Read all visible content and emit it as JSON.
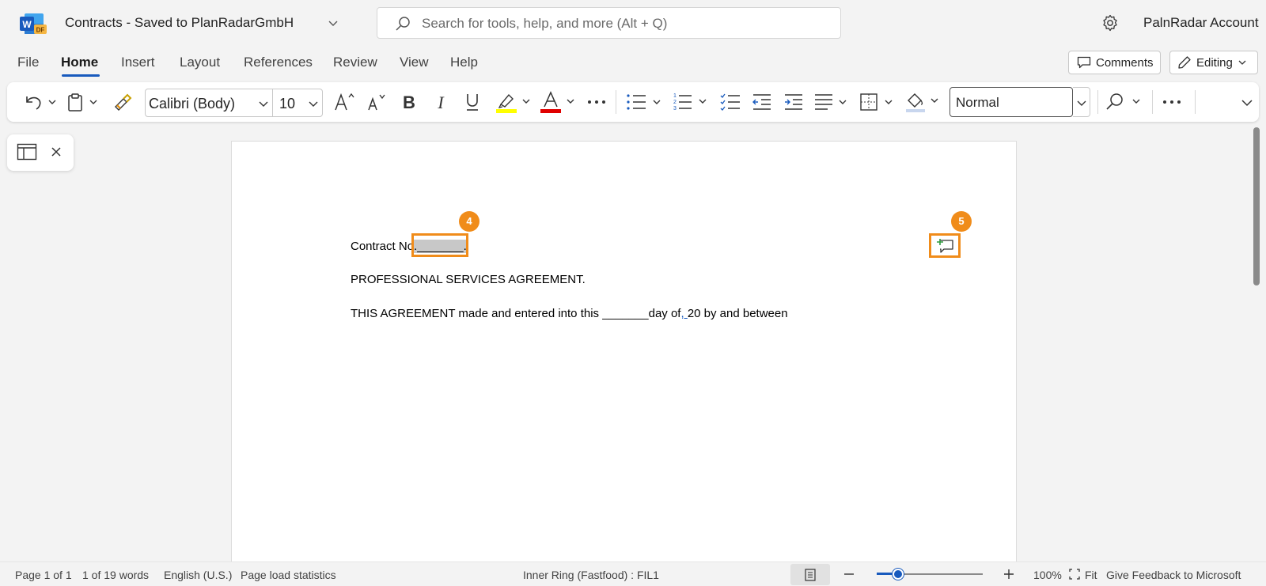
{
  "titlebar": {
    "app_logo": "word-icon",
    "doc_title": "Contracts  -  Saved to PlanRadarGmbH",
    "search_placeholder": "Search for tools, help, and more (Alt + Q)",
    "account": "PalnRadar Account"
  },
  "menu": {
    "tabs": [
      "File",
      "Home",
      "Insert",
      "Layout",
      "References",
      "Review",
      "View",
      "Help"
    ],
    "active_tab": "Home",
    "comments_label": "Comments",
    "editing_label": "Editing"
  },
  "ribbon": {
    "font_name": "Calibri (Body)",
    "font_size": "10",
    "style": "Normal",
    "highlight_color": "#ffff00",
    "font_color": "#e00000"
  },
  "document": {
    "line1_prefix": "Contract No",
    "line1_field": "._______.",
    "line2": "PROFESSIONAL SERVICES AGREEMENT.",
    "line3_a": "THIS AGREEMENT made and entered into this _______day of",
    "line3_field": ", ",
    "line3_b": " 20 by and between"
  },
  "annotations": {
    "badge_4": "4",
    "badge_5": "5",
    "accent": "#f08c1a"
  },
  "statusbar": {
    "page": "Page 1 of 1",
    "words": "1 of 19 words",
    "language": "English (U.S.)",
    "load_stats": "Page load statistics",
    "ring": "Inner Ring (Fastfood) : FIL1",
    "zoom": "100%",
    "fit": "Fit",
    "feedback": "Give Feedback to Microsoft",
    "zoom_fraction": 0.2
  }
}
